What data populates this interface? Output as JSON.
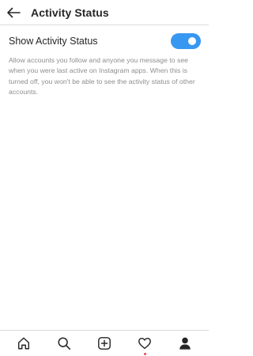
{
  "header": {
    "back_icon": "arrow-left-icon",
    "title": "Activity Status"
  },
  "setting": {
    "label": "Show Activity Status",
    "enabled": true,
    "accent_color": "#3897f0",
    "description": "Allow accounts you follow and anyone you message to see when you were last active on Instagram apps. When this is turned off, you won't be able to see the activity status of other accounts."
  },
  "bottom_nav": {
    "items": [
      {
        "icon": "home-icon"
      },
      {
        "icon": "search-icon"
      },
      {
        "icon": "new-post-icon"
      },
      {
        "icon": "heart-icon",
        "notification": true,
        "notification_color": "#ed4956"
      },
      {
        "icon": "profile-icon",
        "active": true
      }
    ]
  }
}
